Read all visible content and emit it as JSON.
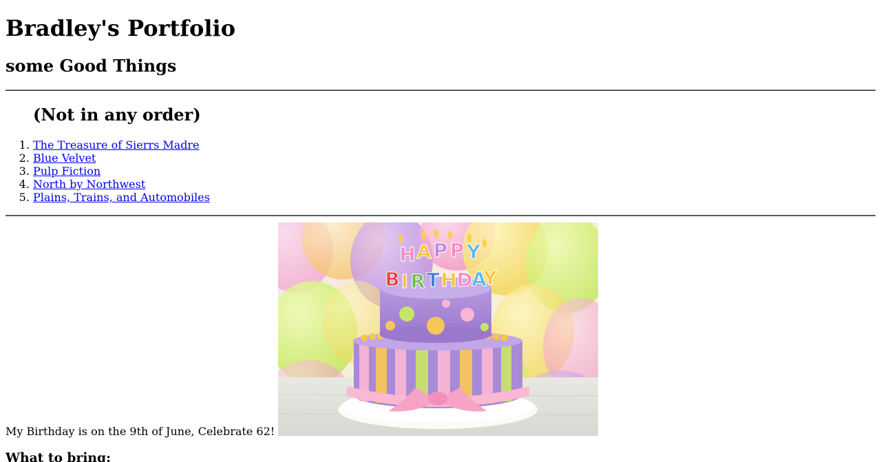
{
  "header": {
    "title": "Bradley's Portfolio",
    "subtitle": "some Good Things"
  },
  "favorites": {
    "heading": "(Not in any order)",
    "items": [
      {
        "label": "The Treasure of Sierrs Madre"
      },
      {
        "label": "Blue Velvet"
      },
      {
        "label": "Pulp Fiction"
      },
      {
        "label": "North by Northwest"
      },
      {
        "label": "Plains, Trains, and Automobiles"
      }
    ]
  },
  "birthday": {
    "text": "My Birthday is on the 9th of June, Celebrate 62!",
    "image_icon": "birthday-cake-photo",
    "cake_letters": [
      "H",
      "A",
      "P",
      "P",
      "Y",
      "B",
      "I",
      "R",
      "T",
      "H",
      "D",
      "A",
      "Y"
    ]
  },
  "bring": {
    "heading": "What to bring:"
  },
  "colors": {
    "link": "#0000ee",
    "text": "#000000",
    "background": "#ffffff"
  }
}
